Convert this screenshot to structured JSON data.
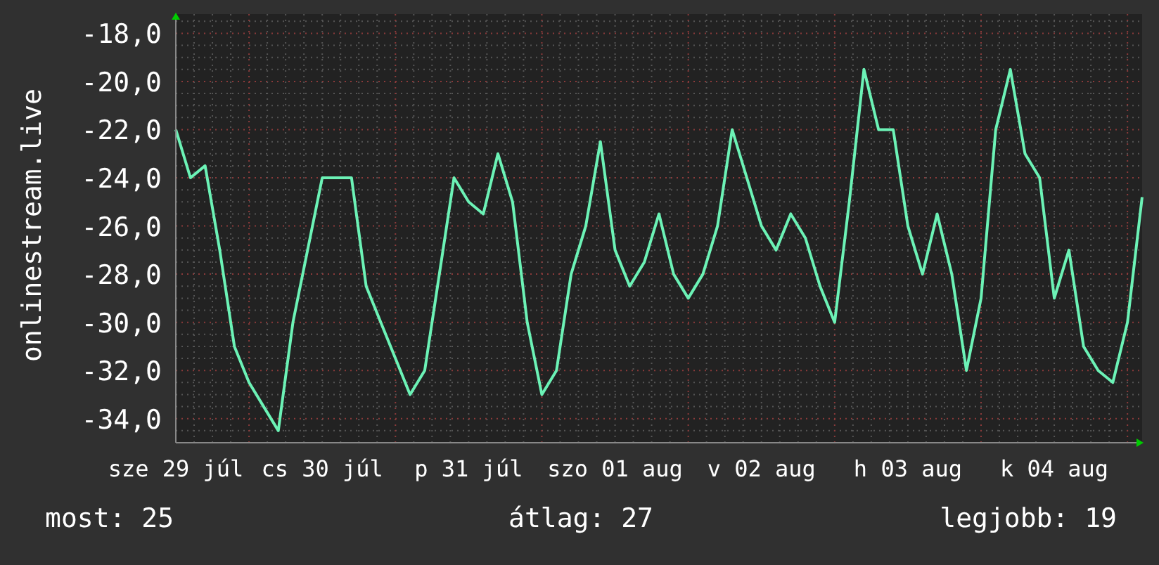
{
  "chart_data": {
    "type": "line",
    "grid": true,
    "ylabel": "onlinestream.live",
    "ylim": [
      -35,
      -17.2
    ],
    "yticks": [
      {
        "value": -18,
        "label": "-18,0"
      },
      {
        "value": -20,
        "label": "-20,0"
      },
      {
        "value": -22,
        "label": "-22,0"
      },
      {
        "value": -24,
        "label": "-24,0"
      },
      {
        "value": -26,
        "label": "-26,0"
      },
      {
        "value": -28,
        "label": "-28,0"
      },
      {
        "value": -30,
        "label": "-30,0"
      },
      {
        "value": -32,
        "label": "-32,0"
      },
      {
        "value": -34,
        "label": "-34,0"
      }
    ],
    "categories": [
      "sze 29 júl",
      null,
      null,
      null,
      null,
      null,
      null,
      null,
      null,
      null,
      "cs 30 júl",
      null,
      null,
      null,
      null,
      null,
      null,
      null,
      null,
      null,
      "p 31 júl",
      null,
      null,
      null,
      null,
      null,
      null,
      null,
      null,
      null,
      "szo 01 aug",
      null,
      null,
      null,
      null,
      null,
      null,
      null,
      null,
      null,
      "v 02 aug",
      null,
      null,
      null,
      null,
      null,
      null,
      null,
      null,
      null,
      "h 03 aug",
      null,
      null,
      null,
      null,
      null,
      null,
      null,
      null,
      null,
      "k 04 aug",
      null,
      null,
      null,
      null,
      null,
      null
    ],
    "series": [
      {
        "color": "#6cf2b6",
        "values": [
          -22,
          -24,
          -23.5,
          -27,
          -31,
          -32.5,
          -33.5,
          -34.5,
          -30,
          -27,
          -24,
          -24,
          -24,
          -28.5,
          -30,
          -31.5,
          -33,
          -32,
          -28,
          -24,
          -25,
          -25.5,
          -23,
          -25,
          -30,
          -33,
          -32,
          -28,
          -26,
          -22.5,
          -27,
          -28.5,
          -27.5,
          -25.5,
          -28,
          -29,
          -28,
          -26,
          -22,
          -24,
          -26,
          -27,
          -25.5,
          -26.5,
          -28.5,
          -30,
          -25,
          -19.5,
          -22,
          -22,
          -26,
          -28,
          -25.5,
          -28,
          -32,
          -29,
          -22,
          -19.5,
          -23,
          -24,
          -29,
          -27,
          -31,
          -32,
          -32.5,
          -30,
          -24.8
        ]
      }
    ]
  },
  "stats": [
    {
      "label": "most: 25"
    },
    {
      "label": "átlag: 27"
    },
    {
      "label": "legjobb: 19"
    }
  ]
}
